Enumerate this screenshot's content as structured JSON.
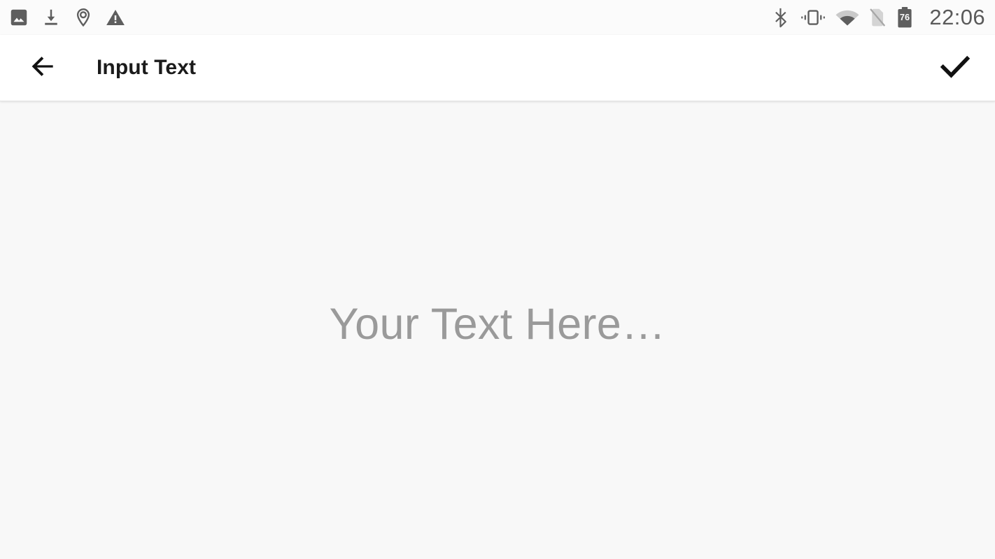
{
  "status_bar": {
    "background_color": "#fbfbfb",
    "icon_color": "#5e5e5e",
    "time": "22:06",
    "left_icons": [
      {
        "name": "image-icon",
        "label": "Screenshot captured"
      },
      {
        "name": "download-icon",
        "label": "Download complete"
      },
      {
        "name": "location-pin-icon",
        "label": "Location active"
      },
      {
        "name": "warning-icon",
        "label": "Warning"
      }
    ],
    "right_icons": [
      {
        "name": "bluetooth-icon",
        "label": "Bluetooth"
      },
      {
        "name": "vibrate-icon",
        "label": "Ringer vibrate"
      },
      {
        "name": "wifi-icon",
        "label": "Wi-Fi connected"
      },
      {
        "name": "no-sim-icon",
        "label": "No SIM card"
      },
      {
        "name": "battery-icon",
        "label": "Battery",
        "level": "76"
      }
    ]
  },
  "app_bar": {
    "background_color": "#ffffff",
    "title": "Input Text",
    "back_button_label": "Navigate up",
    "confirm_button_label": "Done",
    "icons": {
      "back": "arrow-back-icon",
      "confirm": "check-icon"
    }
  },
  "content": {
    "background_color": "#f8f8f8",
    "text_field": {
      "value": "",
      "placeholder": "Your Text Here…",
      "placeholder_color": "#9a9a9a"
    }
  }
}
